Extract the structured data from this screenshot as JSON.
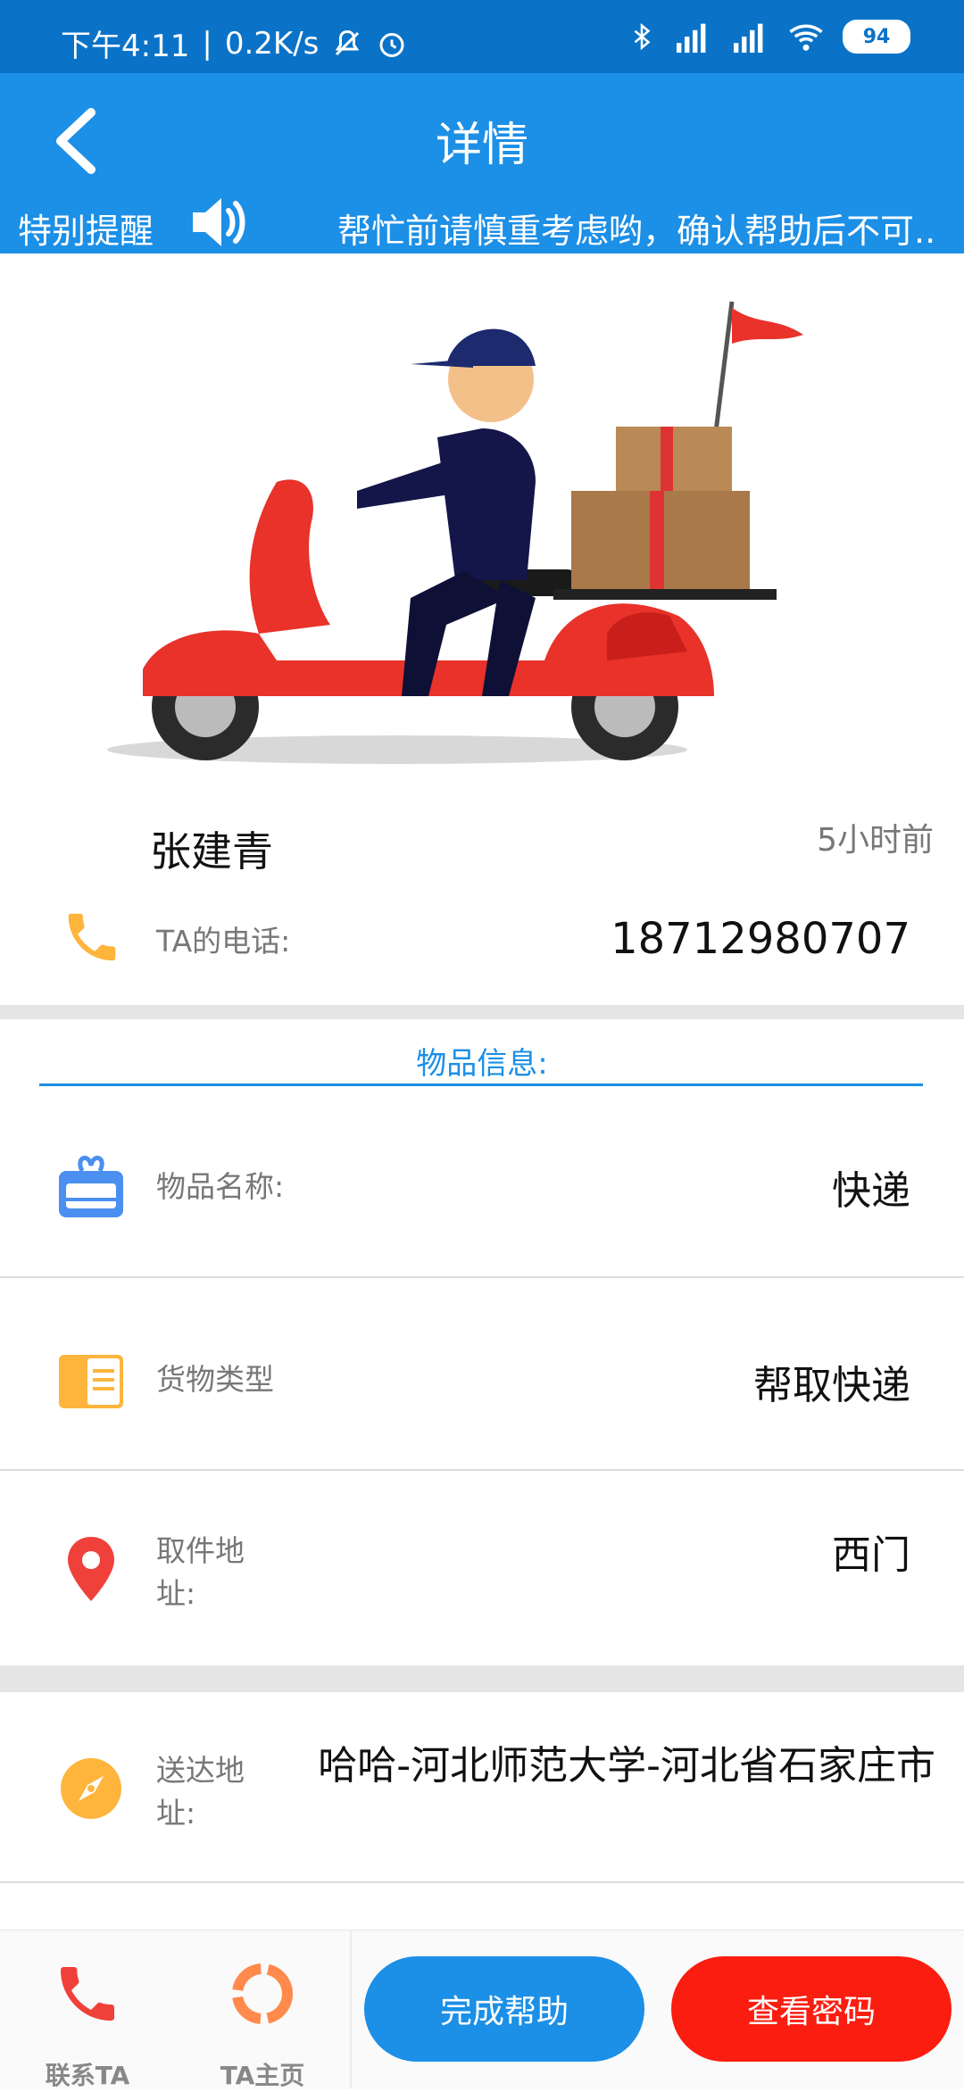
{
  "status_bar": {
    "time": "下午4:11",
    "speed": "0.2K/s",
    "battery": "94"
  },
  "header": {
    "title": "详情",
    "reminder_label": "特别提醒",
    "marquee_text": "帮忙前请慎重考虑哟，确认帮助后不可.."
  },
  "user": {
    "name": "张建青",
    "time_ago": "5小时前",
    "phone_label": "TA的电话:",
    "phone_value": "18712980707"
  },
  "section": {
    "title": "物品信息:"
  },
  "rows": {
    "item_name": {
      "label": "物品名称:",
      "value": "快递",
      "icon": "gift-card-icon"
    },
    "cargo_type": {
      "label": "货物类型",
      "value": "帮取快递",
      "icon": "document-icon"
    },
    "pickup": {
      "label": "取件地址:",
      "value": "西门",
      "icon": "location-pin-icon"
    },
    "delivery": {
      "label": "送达地址:",
      "value": "哈哈-河北师范大学-河北省石家庄市",
      "icon": "compass-icon"
    }
  },
  "bottom_bar": {
    "contact_label": "联系TA",
    "homepage_label": "TA主页",
    "complete_button": "完成帮助",
    "password_button": "查看密码"
  },
  "colors": {
    "status_bar": "#0a73c7",
    "header": "#1c8fe6",
    "accent_blue": "#1c8fe6",
    "accent_red": "#fb1d10",
    "orange": "#ffb43c"
  }
}
